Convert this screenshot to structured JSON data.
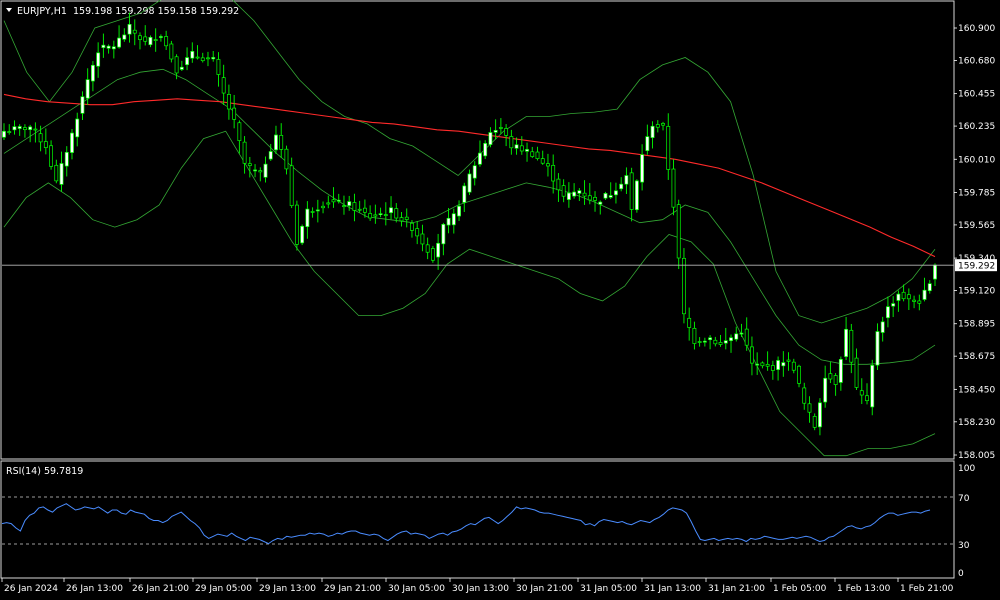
{
  "header": {
    "symbol_timeframe": "EURJPY,H1",
    "ohlc": "159.198 159.298 159.158 159.292"
  },
  "rsi": {
    "label": "RSI(14) 59.7819",
    "scale": [
      "100",
      "70",
      "30",
      "0"
    ],
    "levels": [
      70,
      30
    ],
    "values": [
      47,
      48,
      47,
      43,
      40,
      50,
      55,
      57,
      62,
      63,
      60,
      58,
      62,
      64,
      66,
      63,
      60,
      61,
      63,
      62,
      61,
      63,
      60,
      57,
      60,
      60,
      57,
      56,
      60,
      58,
      57,
      56,
      52,
      50,
      50,
      48,
      50,
      54,
      56,
      58,
      54,
      50,
      47,
      43,
      36,
      33,
      35,
      37,
      36,
      35,
      38,
      35,
      33,
      31,
      34,
      33,
      32,
      30,
      28,
      31,
      33,
      32,
      35,
      34,
      35,
      36,
      36,
      38,
      37,
      38,
      37,
      35,
      36,
      38,
      37,
      39,
      40,
      40,
      38,
      37,
      36,
      37,
      36,
      33,
      31,
      34,
      37,
      39,
      40,
      37,
      38,
      37,
      36,
      33,
      35,
      37,
      38,
      36,
      39,
      40,
      42,
      45,
      47,
      46,
      49,
      52,
      53,
      50,
      47,
      50,
      54,
      58,
      63,
      61,
      62,
      61,
      60,
      58,
      57,
      57,
      56,
      55,
      54,
      53,
      52,
      51,
      50,
      46,
      47,
      45,
      49,
      51,
      50,
      49,
      48,
      49,
      47,
      46,
      48,
      50,
      49,
      48,
      51,
      53,
      56,
      60,
      62,
      61,
      60,
      57,
      49,
      40,
      32,
      31,
      32,
      33,
      31,
      32,
      33,
      32,
      33,
      32,
      30,
      33,
      32,
      33,
      35,
      34,
      33,
      32,
      32,
      33,
      34,
      33,
      34,
      35,
      34,
      32,
      30,
      31,
      34,
      35,
      38,
      41,
      44,
      45,
      43,
      42,
      44,
      45,
      48,
      52,
      55,
      57,
      57,
      55,
      56,
      57,
      58,
      58,
      57,
      59,
      60
    ],
    "colors": {
      "line": "#4a8cff",
      "levels": "#cfcfcf"
    }
  },
  "chart_data": {
    "type": "candlestick",
    "symbol": "EURJPY",
    "timeframe": "H1",
    "current_price": 159.292,
    "current_price_label": "159.292",
    "ylim": [
      158.005,
      160.9
    ],
    "y_ticks": [
      "160.900",
      "160.680",
      "160.455",
      "160.235",
      "160.010",
      "159.785",
      "159.565",
      "159.340",
      "159.120",
      "158.895",
      "158.675",
      "158.450",
      "158.230",
      "158.005"
    ],
    "x_ticks": [
      "26 Jan 2024",
      "26 Jan 13:00",
      "26 Jan 21:00",
      "29 Jan 05:00",
      "29 Jan 13:00",
      "29 Jan 21:00",
      "30 Jan 05:00",
      "30 Jan 13:00",
      "30 Jan 21:00",
      "31 Jan 05:00",
      "31 Jan 13:00",
      "31 Jan 21:00",
      "1 Feb 05:00",
      "1 Feb 13:00",
      "1 Feb 21:00"
    ],
    "close_path": [
      [
        0,
        160.2
      ],
      [
        5,
        160.23
      ],
      [
        8,
        160.1
      ],
      [
        10,
        159.85
      ],
      [
        13,
        160.18
      ],
      [
        16,
        160.55
      ],
      [
        18,
        160.75
      ],
      [
        21,
        160.78
      ],
      [
        24,
        160.9
      ],
      [
        27,
        160.8
      ],
      [
        30,
        160.86
      ],
      [
        33,
        160.62
      ],
      [
        36,
        160.72
      ],
      [
        40,
        160.68
      ],
      [
        42,
        160.45
      ],
      [
        44,
        160.26
      ],
      [
        46,
        159.98
      ],
      [
        49,
        159.9
      ],
      [
        52,
        160.18
      ],
      [
        54,
        159.95
      ],
      [
        56,
        159.45
      ],
      [
        58,
        159.66
      ],
      [
        62,
        159.72
      ],
      [
        66,
        159.7
      ],
      [
        70,
        159.62
      ],
      [
        74,
        159.66
      ],
      [
        78,
        159.55
      ],
      [
        80,
        159.45
      ],
      [
        82,
        159.35
      ],
      [
        84,
        159.55
      ],
      [
        86,
        159.62
      ],
      [
        89,
        159.9
      ],
      [
        91,
        160.05
      ],
      [
        93,
        160.2
      ],
      [
        95,
        160.22
      ],
      [
        97,
        160.1
      ],
      [
        99,
        160.08
      ],
      [
        101,
        160.05
      ],
      [
        104,
        159.95
      ],
      [
        107,
        159.75
      ],
      [
        110,
        159.8
      ],
      [
        113,
        159.72
      ],
      [
        116,
        159.78
      ],
      [
        119,
        159.9
      ],
      [
        120,
        159.66
      ],
      [
        122,
        160.05
      ],
      [
        124,
        160.25
      ],
      [
        126,
        160.22
      ],
      [
        127,
        159.95
      ],
      [
        128,
        159.7
      ],
      [
        130,
        158.95
      ],
      [
        132,
        158.78
      ],
      [
        135,
        158.8
      ],
      [
        137,
        158.75
      ],
      [
        139,
        158.8
      ],
      [
        141,
        158.85
      ],
      [
        143,
        158.62
      ],
      [
        145,
        158.6
      ],
      [
        147,
        158.6
      ],
      [
        149,
        158.65
      ],
      [
        151,
        158.6
      ],
      [
        153,
        158.35
      ],
      [
        155,
        158.2
      ],
      [
        157,
        158.55
      ],
      [
        159,
        158.5
      ],
      [
        161,
        158.85
      ],
      [
        163,
        158.45
      ],
      [
        165,
        158.35
      ],
      [
        167,
        158.85
      ],
      [
        169,
        159.0
      ],
      [
        171,
        159.1
      ],
      [
        173,
        159.05
      ],
      [
        175,
        159.05
      ],
      [
        177,
        159.15
      ],
      [
        178,
        159.29
      ]
    ],
    "series": [
      {
        "name": "MA",
        "color": "#ff2a2a",
        "values": [
          160.45,
          160.42,
          160.4,
          160.39,
          160.38,
          160.38,
          160.4,
          160.41,
          160.42,
          160.41,
          160.4,
          160.38,
          160.36,
          160.34,
          160.32,
          160.3,
          160.28,
          160.26,
          160.25,
          160.23,
          160.21,
          160.2,
          160.18,
          160.16,
          160.14,
          160.12,
          160.1,
          160.08,
          160.07,
          160.05,
          160.03,
          160.01,
          159.98,
          159.95,
          159.9,
          159.85,
          159.79,
          159.73,
          159.67,
          159.61,
          159.55,
          159.48,
          159.42,
          159.35
        ]
      },
      {
        "name": "BB Upper",
        "color": "#34a834",
        "values": [
          160.95,
          160.6,
          160.4,
          160.6,
          160.9,
          160.95,
          161.0,
          161.1,
          161.2,
          161.25,
          161.1,
          160.95,
          160.75,
          160.55,
          160.4,
          160.3,
          160.25,
          160.15,
          160.1,
          160.0,
          159.9,
          160.05,
          160.2,
          160.3,
          160.3,
          160.32,
          160.33,
          160.35,
          160.55,
          160.65,
          160.7,
          160.6,
          160.4,
          159.9,
          159.25,
          158.95,
          158.9,
          158.95,
          159.0,
          159.08,
          159.2,
          159.4
        ]
      },
      {
        "name": "BB Middle",
        "color": "#34a834",
        "values": [
          160.05,
          160.15,
          160.25,
          160.35,
          160.45,
          160.55,
          160.6,
          160.62,
          160.55,
          160.45,
          160.35,
          160.2,
          160.05,
          159.92,
          159.8,
          159.7,
          159.62,
          159.6,
          159.58,
          159.62,
          159.7,
          159.75,
          159.8,
          159.85,
          159.82,
          159.78,
          159.72,
          159.65,
          159.58,
          159.6,
          159.7,
          159.65,
          159.45,
          159.2,
          158.95,
          158.75,
          158.65,
          158.62,
          158.62,
          158.63,
          158.65,
          158.75
        ]
      },
      {
        "name": "BB Lower",
        "color": "#34a834",
        "values": [
          159.55,
          159.75,
          159.85,
          159.75,
          159.6,
          159.55,
          159.6,
          159.7,
          159.95,
          160.15,
          160.2,
          159.95,
          159.7,
          159.45,
          159.25,
          159.1,
          158.95,
          158.95,
          159.0,
          159.1,
          159.3,
          159.4,
          159.35,
          159.3,
          159.25,
          159.2,
          159.1,
          159.05,
          159.15,
          159.35,
          159.5,
          159.45,
          159.3,
          158.9,
          158.6,
          158.3,
          158.15,
          158.0,
          158.0,
          158.05,
          158.05,
          158.08,
          158.15
        ]
      }
    ],
    "colors": {
      "background": "#000000",
      "bull_body": "#ffffff",
      "bear_body": "#000000",
      "candle_outline": "#00ff00",
      "grid_text": "#ffffff",
      "price_line": "#b8b8b8"
    }
  }
}
